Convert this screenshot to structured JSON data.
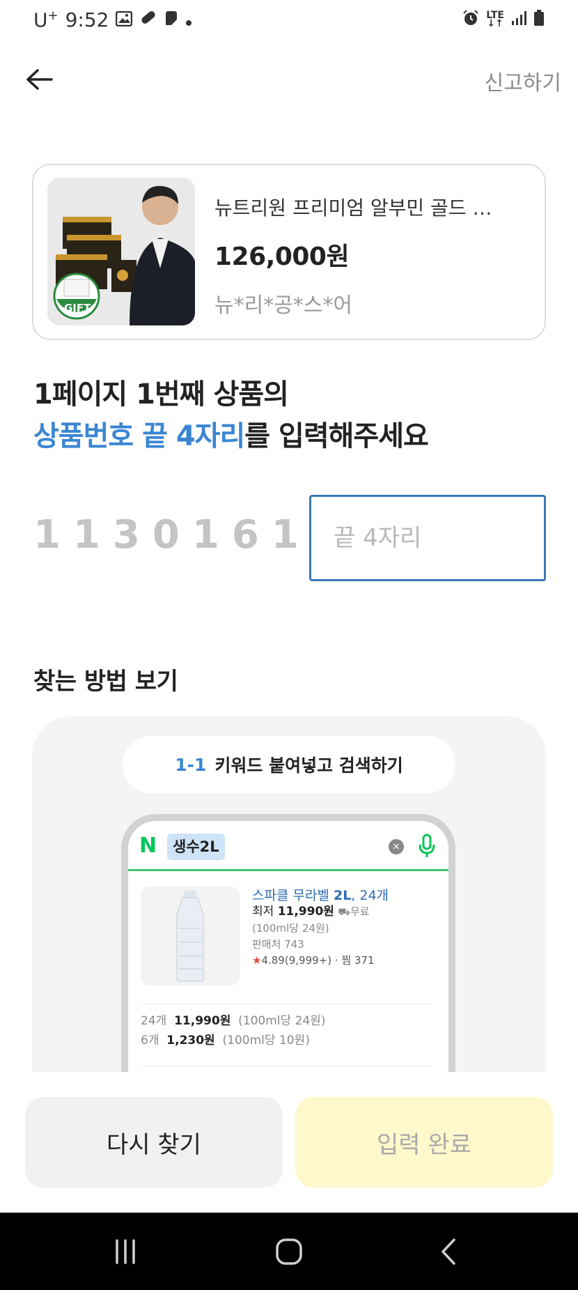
{
  "status_bar": {
    "carrier": "U",
    "carrier_sup": "+",
    "time": "9:52",
    "network": "LTE"
  },
  "header": {
    "report_label": "신고하기"
  },
  "product": {
    "name": "뉴트리원 프리미엄 알부민 골드 …",
    "price": "126,000원",
    "seller": "뉴*리*공*스*어",
    "gift_badge": "GIFT"
  },
  "instruction": {
    "line1": "1페이지 1번째 상품의",
    "line2_accent": "상품번호 끝 4자리",
    "line2_rest": "를 입력해주세요"
  },
  "product_number": {
    "prefix": "1130161",
    "input_value": "",
    "input_placeholder": "끝 4자리"
  },
  "howto": {
    "title": "찾는 방법 보기",
    "step_number": "1-1",
    "step_text": "키워드 붙여넣고 검색하기",
    "search_logo": "N",
    "search_query": "생수2L",
    "result": {
      "title_prefix": "스파클 무라벨 ",
      "title_bold": "2L",
      "title_suffix": ", 24개",
      "price_label": "최저 ",
      "price_value": "11,990원",
      "shipping": "무료",
      "unit_price": "(100ml당 24원)",
      "sellers": "판매처 743",
      "rating": "4.89",
      "review_count": "(9,999+)",
      "wishlist": "찜 371"
    },
    "offers": [
      {
        "qty": "24개",
        "price": "11,990원",
        "unit": "(100ml당 24원)"
      },
      {
        "qty": "6개",
        "price": "1,230원",
        "unit": "(100ml당 10원)"
      }
    ]
  },
  "buttons": {
    "retry": "다시 찾기",
    "done": "입력 완료"
  },
  "colors": {
    "accent_blue": "#3a86d4",
    "input_border": "#3a78b8",
    "done_button_bg": "#fff8cc",
    "naver_green": "#03c75a"
  }
}
